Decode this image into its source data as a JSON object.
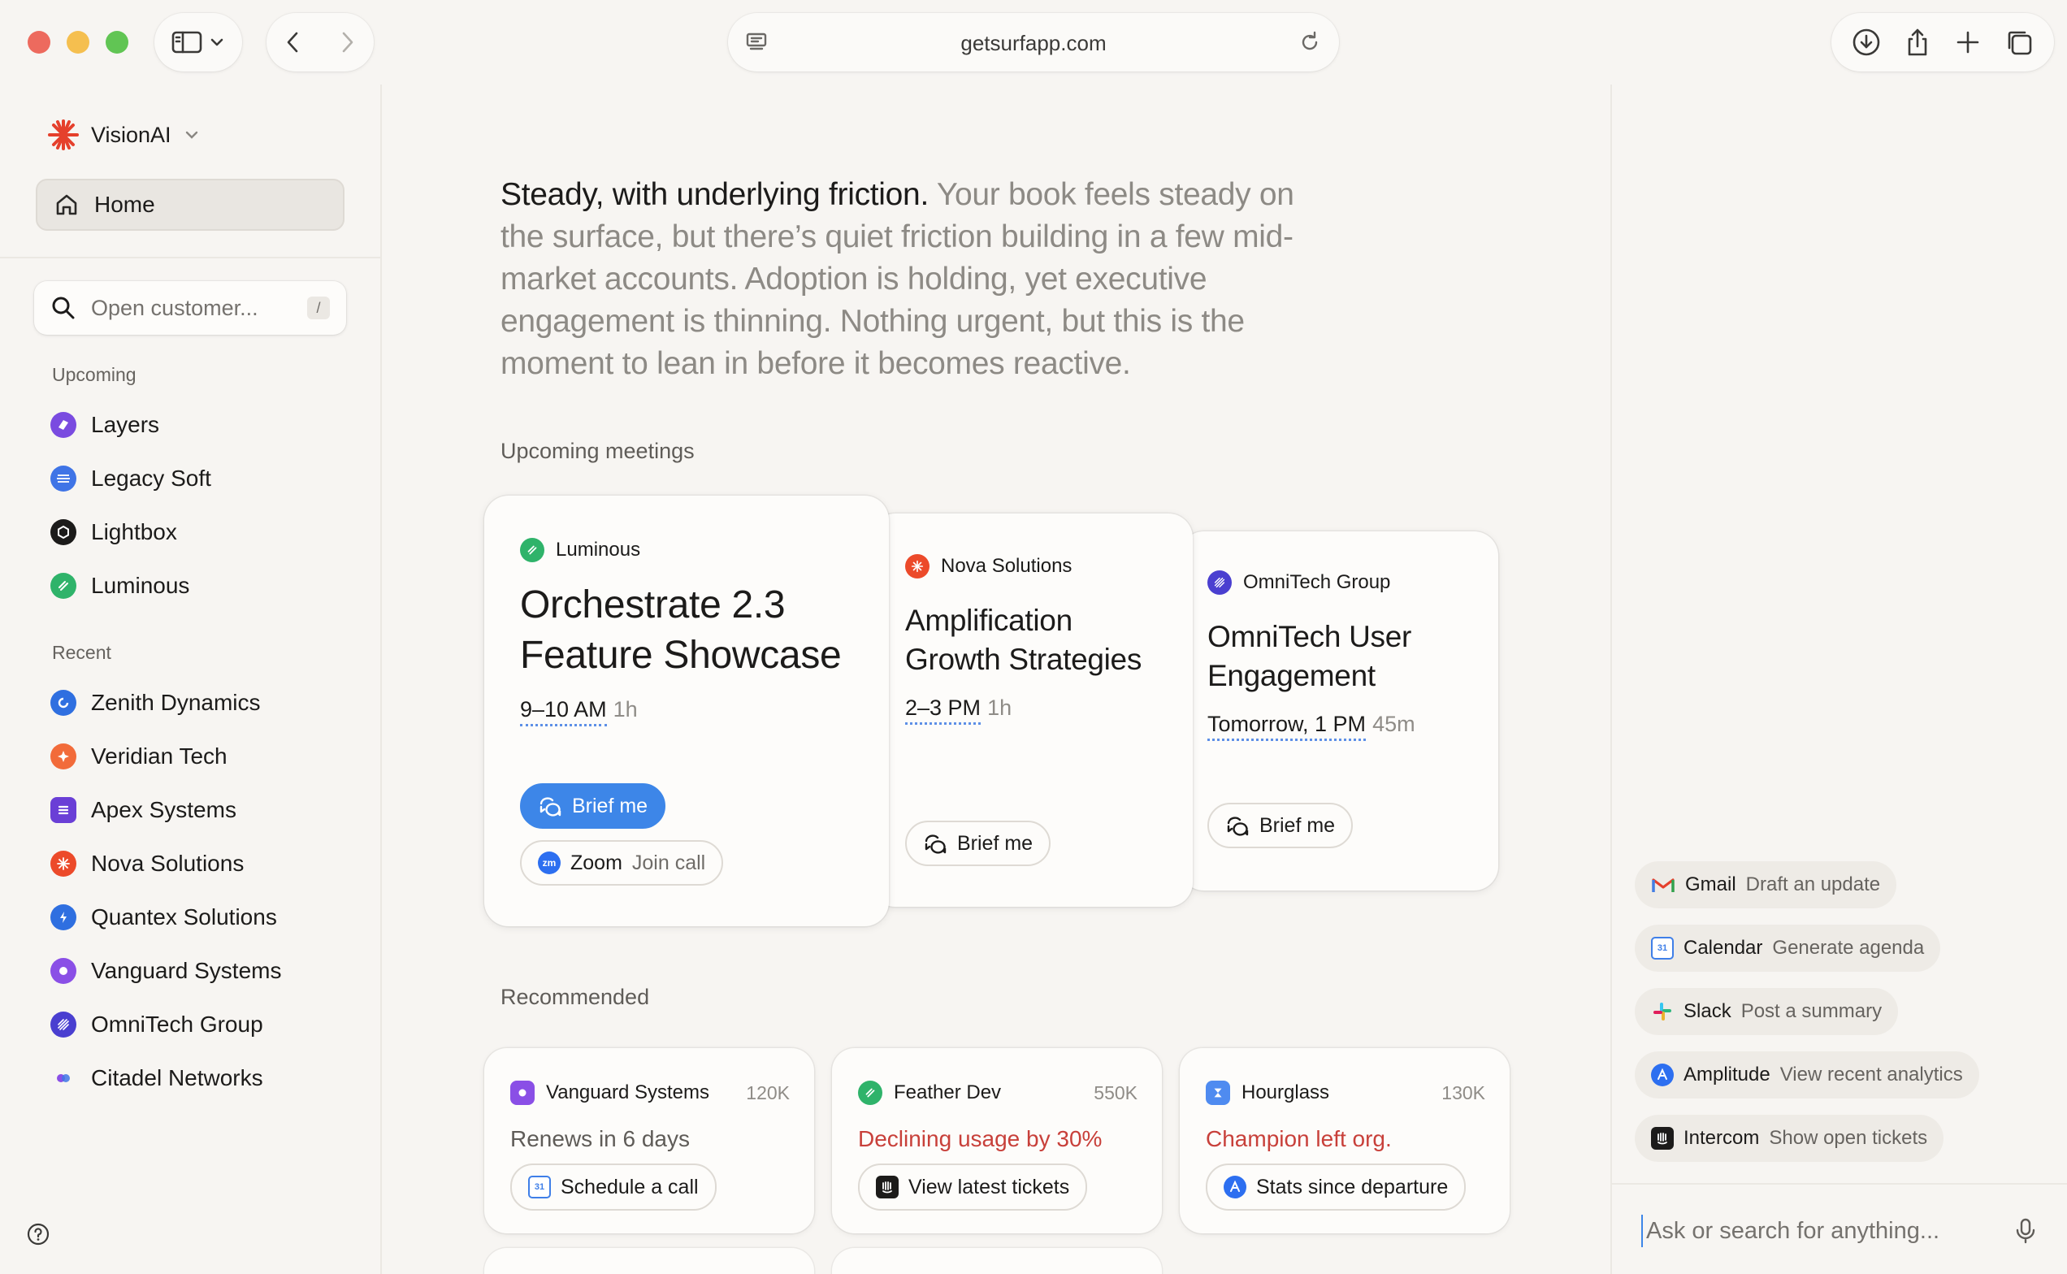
{
  "browser": {
    "url": "getsurfapp.com"
  },
  "sidebar": {
    "brand": "VisionAI",
    "home_label": "Home",
    "search_placeholder": "Open customer...",
    "search_shortcut": "/",
    "upcoming_label": "Upcoming",
    "upcoming": [
      {
        "label": "Layers",
        "icon": "layers-logo-icon"
      },
      {
        "label": "Legacy Soft",
        "icon": "legacy-soft-logo-icon"
      },
      {
        "label": "Lightbox",
        "icon": "lightbox-logo-icon"
      },
      {
        "label": "Luminous",
        "icon": "luminous-logo-icon"
      }
    ],
    "recent_label": "Recent",
    "recent": [
      {
        "label": "Zenith Dynamics",
        "icon": "zenith-logo-icon"
      },
      {
        "label": "Veridian Tech",
        "icon": "veridian-logo-icon"
      },
      {
        "label": "Apex Systems",
        "icon": "apex-logo-icon"
      },
      {
        "label": "Nova Solutions",
        "icon": "nova-logo-icon"
      },
      {
        "label": "Quantex Solutions",
        "icon": "quantex-logo-icon"
      },
      {
        "label": "Vanguard Systems",
        "icon": "vanguard-logo-icon"
      },
      {
        "label": "OmniTech Group",
        "icon": "omnitech-logo-icon"
      },
      {
        "label": "Citadel Networks",
        "icon": "citadel-logo-icon"
      }
    ]
  },
  "main": {
    "summary_strong": "Steady, with underlying friction.",
    "summary_soft": " Your book feels steady on the surface, but there’s quiet friction building in a few mid-market accounts. Adoption is holding, yet executive engagement is thinning. Nothing urgent, but this is the moment to lean in before it becomes reactive.",
    "meetings_label": "Upcoming meetings",
    "meetings": [
      {
        "company": "Luminous",
        "title_line1": "Orchestrate 2.3",
        "title_line2": "Feature Showcase",
        "time": "9–10 AM",
        "duration": "1h",
        "brief_label": "Brief me",
        "zoom_app": "Zoom",
        "zoom_action": "Join call"
      },
      {
        "company": "Nova Solutions",
        "title_line1": "Amplification",
        "title_line2": "Growth Strategies",
        "time": "2–3 PM",
        "duration": "1h",
        "brief_label": "Brief me"
      },
      {
        "company": "OmniTech Group",
        "title_line1": "OmniTech User",
        "title_line2": "Engagement",
        "time": "Tomorrow, 1 PM",
        "duration": "45m",
        "brief_label": "Brief me"
      }
    ],
    "recommended_label": "Recommended",
    "recommended": [
      {
        "company": "Vanguard Systems",
        "amount": "120K",
        "status": "Renews in 6 days",
        "action": "Schedule a call"
      },
      {
        "company": "Feather Dev",
        "amount": "550K",
        "status": "Declining usage by 30%",
        "action": "View latest tickets"
      },
      {
        "company": "Hourglass",
        "amount": "130K",
        "status": "Champion left org.",
        "action": "Stats since departure"
      }
    ]
  },
  "assistant": {
    "suggestions": [
      {
        "app": "Gmail",
        "action": "Draft an update"
      },
      {
        "app": "Calendar",
        "action": "Generate agenda"
      },
      {
        "app": "Slack",
        "action": "Post a summary"
      },
      {
        "app": "Amplitude",
        "action": "View recent analytics"
      },
      {
        "app": "Intercom",
        "action": "Show open tickets"
      }
    ],
    "ask_placeholder": "Ask or search for anything..."
  },
  "colors": {
    "accent": "#3d86e8",
    "alert": "#c8403a",
    "background": "#f7f5f2"
  }
}
